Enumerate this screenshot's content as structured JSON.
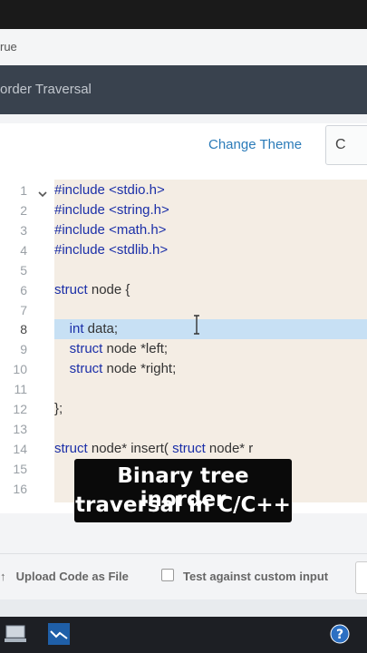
{
  "browser": {
    "url_fragment": "rue"
  },
  "page": {
    "title": "order Traversal"
  },
  "toolbar": {
    "change_theme": "Change Theme",
    "language": "C"
  },
  "editor": {
    "line_numbers": [
      "1",
      "2",
      "3",
      "4",
      "5",
      "6",
      "7",
      "8",
      "9",
      "10",
      "11",
      "12",
      "13",
      "14",
      "15",
      "16"
    ],
    "active_line": 8
  },
  "caption": {
    "line1": "Binary tree inorder",
    "line2": "traversal in C/C++"
  },
  "footer": {
    "upload_label": "Upload Code as File",
    "custom_input_label": "Test against custom input"
  },
  "colors": {
    "accent": "#2b7bb9",
    "title_bar": "#39424e",
    "highlight": "#c7e0f4",
    "keyword": "#1b2fa8"
  }
}
